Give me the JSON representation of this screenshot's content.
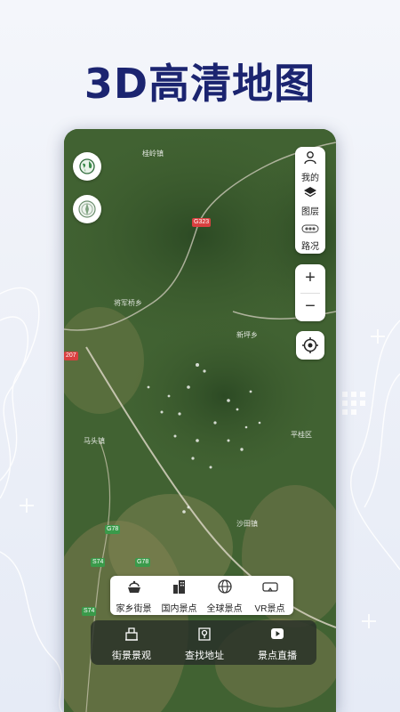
{
  "headline": "3D高清地图",
  "map": {
    "roads": [
      {
        "label": "G323",
        "color": "#d94040"
      },
      {
        "label": "207",
        "color": "#d94040"
      },
      {
        "label": "G78",
        "color": "#3a9a4a"
      },
      {
        "label": "S74",
        "color": "#3a9a4a"
      },
      {
        "label": "G78",
        "color": "#3a9a4a"
      },
      {
        "label": "S74",
        "color": "#3a9a4a"
      }
    ],
    "places": [
      "桂岭镇",
      "马头镇",
      "沙田镇",
      "新坪乡",
      "将军桥乡",
      "平桂区"
    ]
  },
  "left_buttons": {
    "globe_icon": "globe-icon",
    "compass_icon": "compass-icon"
  },
  "right_panel": {
    "items": [
      {
        "label": "我的",
        "icon": "person-icon"
      },
      {
        "label": "图层",
        "icon": "layers-icon"
      },
      {
        "label": "路况",
        "icon": "traffic-icon"
      }
    ]
  },
  "zoom": {
    "plus": "+",
    "minus": "−"
  },
  "locate_icon": "locate-icon",
  "feature_bar": [
    {
      "label": "家乡街景",
      "icon": "hometown-icon"
    },
    {
      "label": "国内景点",
      "icon": "buildings-icon"
    },
    {
      "label": "全球景点",
      "icon": "globe-icon"
    },
    {
      "label": "VR景点",
      "icon": "vr-icon"
    }
  ],
  "bottom_bar": [
    {
      "label": "街景景观",
      "icon": "street-view-icon"
    },
    {
      "label": "查找地址",
      "icon": "map-search-icon"
    },
    {
      "label": "景点直播",
      "icon": "live-play-icon"
    }
  ],
  "colors": {
    "headline": "#1b2470",
    "bottom_bar_bg": "#283028"
  }
}
